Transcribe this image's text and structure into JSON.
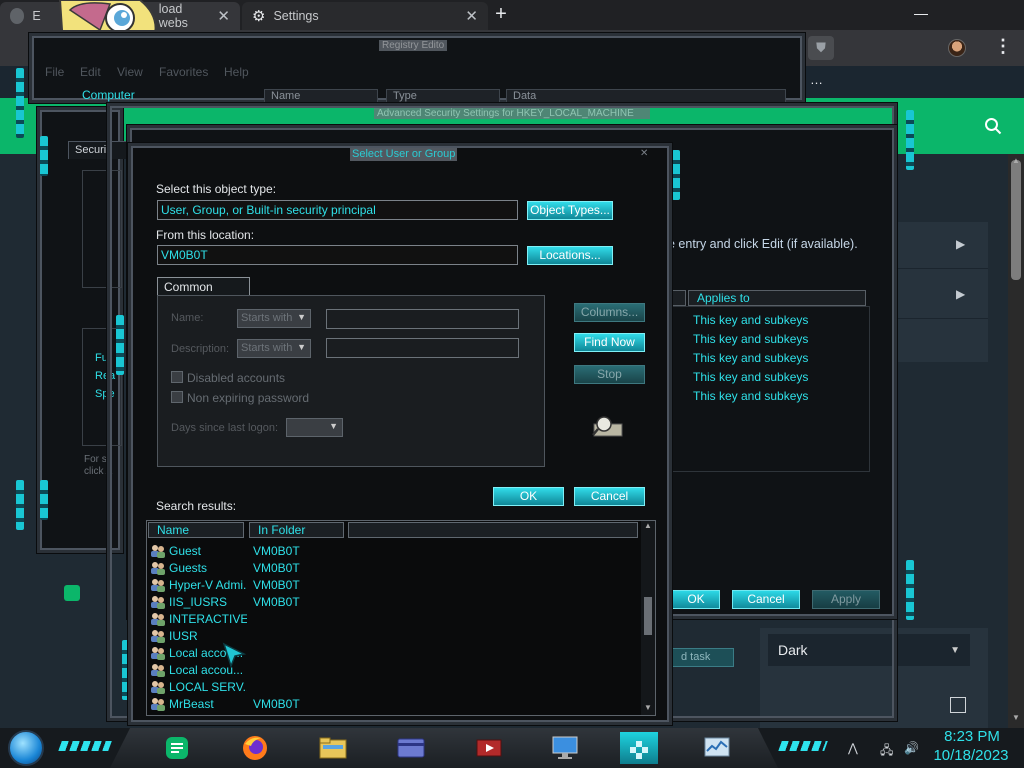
{
  "browser": {
    "tab1_label": "E",
    "tab1_label_b": "load webs",
    "tab2_label": "Settings",
    "toolbar_partial_text": "…"
  },
  "page": {
    "instruction_text": "e entry and click Edit (if available).",
    "theme_select_value": "Dark",
    "add_task_label": "d task"
  },
  "registry_editor": {
    "title": "Registry Edito",
    "menu": [
      "File",
      "Edit",
      "View",
      "Favorites",
      "Help"
    ],
    "tree_root": "Computer",
    "columns": [
      "Name",
      "Type",
      "Data"
    ]
  },
  "permissions": {
    "tab_label": "Securi",
    "permissions_items": [
      "Full",
      "Rea",
      "Spe"
    ],
    "footer_text_1": "For sp",
    "footer_text_2": "click A"
  },
  "advanced_security": {
    "title": "Advanced Security Settings for HKEY_LOCAL_MACHINE",
    "applies_to_header": "Applies to",
    "applies_to_rows": [
      "This key and subkeys",
      "This key and subkeys",
      "This key and subkeys",
      "This key and subkeys",
      "This key and subkeys"
    ],
    "ok_label": "OK",
    "cancel_label": "Cancel",
    "apply_label": "Apply"
  },
  "select_user_dialog": {
    "title": "Select User or Group",
    "object_type_label": "Select this object type:",
    "object_type_value": "User, Group, or Built-in security principal",
    "object_types_button": "Object Types...",
    "location_label": "From this location:",
    "location_value": "VM0B0T",
    "locations_button": "Locations...",
    "common_queries_tab": "Common Queries",
    "name_label": "Name:",
    "description_label": "Description:",
    "starts_with": "Starts with",
    "disabled_accounts": "Disabled accounts",
    "non_expiring_password": "Non expiring password",
    "days_since_last_logon": "Days since last logon:",
    "columns_button": "Columns...",
    "find_now_button": "Find Now",
    "stop_button": "Stop",
    "ok_button": "OK",
    "cancel_button": "Cancel",
    "search_results_label": "Search results:",
    "results_columns": [
      "Name",
      "In Folder"
    ],
    "results": [
      {
        "name": "Guest",
        "folder": "VM0B0T"
      },
      {
        "name": "Guests",
        "folder": "VM0B0T"
      },
      {
        "name": "Hyper-V Admi...",
        "folder": "VM0B0T"
      },
      {
        "name": "IIS_IUSRS",
        "folder": "VM0B0T"
      },
      {
        "name": "INTERACTIVE",
        "folder": ""
      },
      {
        "name": "IUSR",
        "folder": ""
      },
      {
        "name": "Local accou...",
        "folder": ""
      },
      {
        "name": "Local accou...",
        "folder": ""
      },
      {
        "name": "LOCAL SERV...",
        "folder": ""
      },
      {
        "name": "MrBeast",
        "folder": "VM0B0T"
      }
    ]
  },
  "taskbar": {
    "time": "8:23 PM",
    "date": "10/18/2023",
    "apps": [
      "green-app",
      "firefox",
      "file-explorer",
      "control-panel",
      "media",
      "remote-desktop",
      "regedit",
      "system-monitor"
    ]
  },
  "colors": {
    "accent_cyan": "#2fe0e8",
    "settings_green": "#0bb66a"
  }
}
